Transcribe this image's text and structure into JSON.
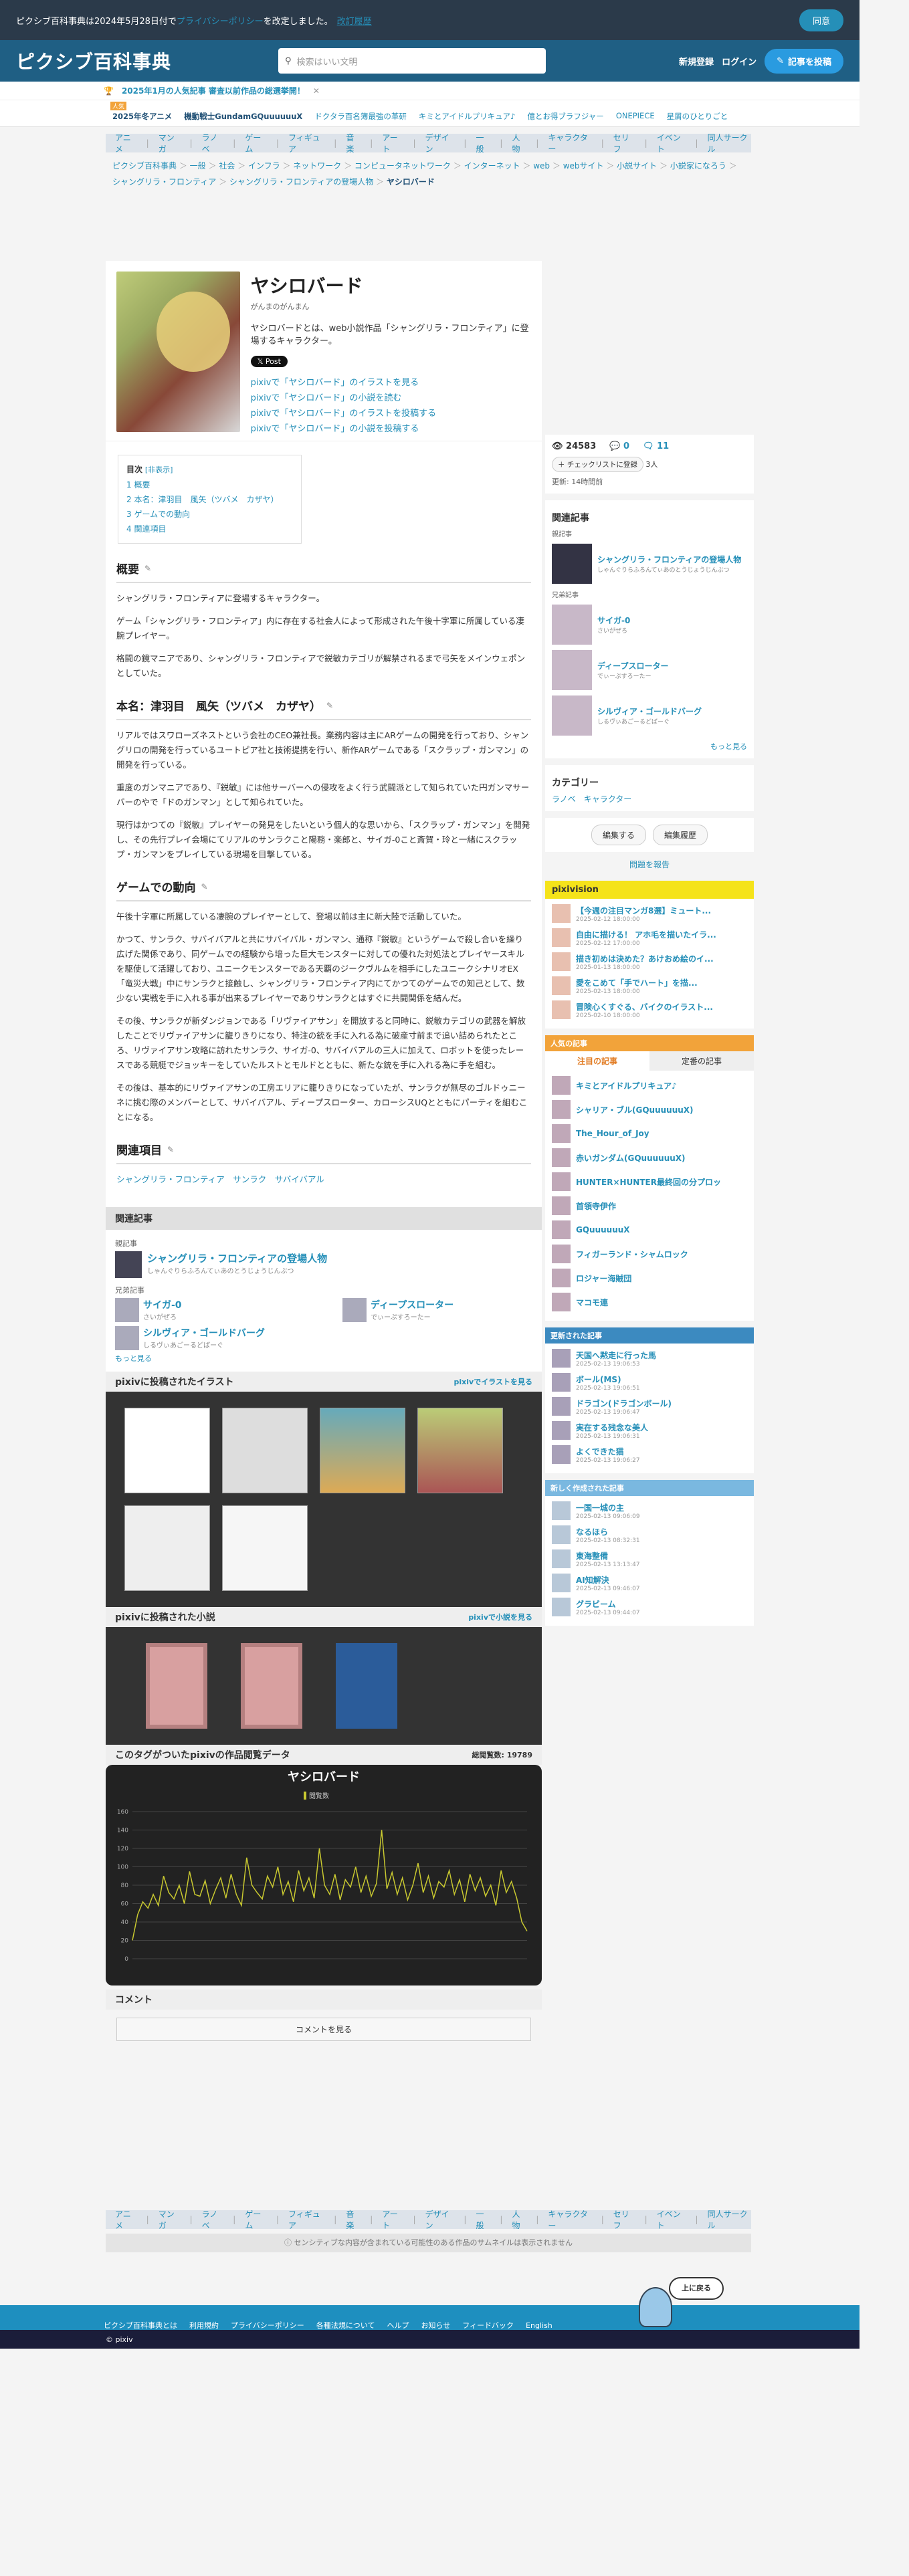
{
  "cookie": {
    "text": "ピクシブ百科事典は2024年5月28日付で",
    "link": "プライバシーポリシー",
    "text2": "を改定しました。",
    "link2": "改訂履歴",
    "agree": "同意"
  },
  "header": {
    "logo": "ピクシブ百科事典",
    "search_placeholder": "検索はいい文明",
    "signup": "新規登録",
    "login": "ログイン",
    "post": "記事を投稿"
  },
  "banner": {
    "icon": "🏆",
    "text": "2025年1月の人気記事 審査以前作品の総選挙開！",
    "close": "✕"
  },
  "trend": {
    "tag": "人気",
    "items": [
      "2025年冬アニメ",
      "機動戦士GundamGQuuuuuuX",
      "ドクタラ百名簿最強の革研",
      "キミとアイドルプリキュア♪",
      "億とお得ブラフジャー",
      "ONEPIECE",
      "星屑のひとりごと"
    ]
  },
  "catbar": [
    "アニメ",
    "マンガ",
    "ラノベ",
    "ゲーム",
    "フィギュア",
    "音楽",
    "アート",
    "デザイン",
    "一般",
    "人物",
    "キャラクター",
    "セリフ",
    "イベント",
    "同人サークル"
  ],
  "breadcrumb": [
    "ピクシブ百科事典",
    "一般",
    "社会",
    "インフラ",
    "ネットワーク",
    "コンピュータネットワーク",
    "インターネット",
    "web",
    "webサイト",
    "小説サイト",
    "小説家になろう",
    "シャングリラ・フロンティア",
    "シャングリラ・フロンティアの登場人物",
    "ヤシロバード"
  ],
  "article": {
    "title": "ヤシロバード",
    "yomi": "がんまのがんまん",
    "desc": "ヤシロバードとは、web小説作品「シャングリラ・フロンティア」に登場するキャラクター。",
    "xpost": "𝕏 Post",
    "plinks": [
      "pixivで「ヤシロバード」のイラストを見る",
      "pixivで「ヤシロバード」の小説を読む",
      "pixivで「ヤシロバード」のイラストを投稿する",
      "pixivで「ヤシロバード」の小説を投稿する"
    ]
  },
  "toc": {
    "head": "目次",
    "hide": "[非表示]",
    "items": [
      "1 概要",
      "2 本名：津羽目　風矢（ツバメ　カザヤ）",
      "3 ゲームでの動向",
      "4 関連項目"
    ]
  },
  "sections": [
    {
      "h": "概要",
      "p": [
        "シャングリラ・フロンティアに登場するキャラクター。",
        "ゲーム「シャングリラ・フロンティア」内に存在する社会人によって形成された午後十字軍に所属している凄腕プレイヤー。",
        "格闘の鏡マニアであり、シャングリラ・フロンティアで鋭敏カテゴリが解禁されるまで弓矢をメインウェポンとしていた。"
      ]
    },
    {
      "h": "本名：津羽目　風矢（ツバメ　カザヤ）",
      "p": [
        "リアルではスワローズネストという会社のCEO兼社長。業務内容は主にARゲームの開発を行っており、シャングリロの開発を行っているユートピア社と技術提携を行い、新作ARゲームである「スクラップ・ガンマン」の開発を行っている。",
        "重度のガンマニアであり、『鋭敏』には他サーバーへの侵攻をよく行う武闘派として知られていた円ガンマサーバーのやで「ドのガンマン」として知られていた。",
        "現行はかつての『鋭敏』プレイヤーの発見をしたいという個人的な思いから、「スクラップ・ガンマン」を開発し、その先行プレイ会場にてリアルのサンラクこと陽務・楽郎と、サイガ-0こと斎賀・玲と一緒にスクラップ・ガンマンをプレイしている現場を目撃している。"
      ]
    },
    {
      "h": "ゲームでの動向",
      "p": [
        "午後十字軍に所属している凄腕のプレイヤーとして、登場以前は主に新大陸で活動していた。",
        "かつて、サンラク、サバイバアルと共にサバイバル・ガンマン、通称『鋭敏』というゲームで殺し合いを繰り広げた関係であり、同ゲームでの経験から培った巨大モンスターに対しての優れた対処法とプレイヤースキルを駆使して活躍しており、ユニークモンスターである天覇のジークヴルムを相手にしたユニークシナリオEX「竜災大戦」中にサンラクと接触し、シャングリラ・フロンティア内にてかつてのゲームでの知己として、数少ない実戦を手に入れる事が出来るプレイヤーでありサンラクとはすぐに共闘関係を結んだ。",
        "その後、サンラクが新ダンジョンである「リヴァイアサン」を開放すると同時に、鋭敏カテゴリの武器を解放したことでリヴァイアサンに籠りきりになり、特注の銃を手に入れる為に破産寸前まで追い詰められたところ、リヴァイアサン攻略に訪れたサンラク、サイガ-0、サバイバアルの三人に加えて、ロボットを使ったレースである競艇でジョッキーをしていたルストとモルドとともに、新たな銃を手に入れる為に手を組む。",
        "その後は、基本的にリヴァイアサンの工房エリアに籠りきりになっていたが、サンラクが無尽のゴルドゥニーネに挑む際のメンバーとして、サバイバアル、ディープスローター、カローシスUQとともにパーティを組むことになる。"
      ]
    },
    {
      "h": "関連項目",
      "p": [
        "シャングリラ・フロンティア　サンラク　サバイバアル"
      ]
    }
  ],
  "related": {
    "head": "関連記事",
    "parent_label": "親記事",
    "parent": "シャングリラ・フロンティアの登場人物",
    "parent_yomi": "しゃんぐりらふろんてぃあのとうじょうじんぶつ",
    "sib_label": "兄弟記事",
    "sibs": [
      {
        "t": "サイガ-0",
        "y": "さいがぜろ"
      },
      {
        "t": "ディープスローター",
        "y": "でぃーぷすろーたー"
      },
      {
        "t": "シルヴィア・ゴールドバーグ",
        "y": "しるヴぃあごーるどばーぐ"
      }
    ],
    "more": "もっと見る"
  },
  "illust": {
    "head": "pixivに投稿されたイラスト",
    "link": "pixivでイラストを見る"
  },
  "novel": {
    "head": "pixivに投稿された小説",
    "link": "pixivで小説を見る"
  },
  "views": {
    "head": "このタグがついたpixivの作品閲覧データ",
    "total_label": "総閲覧数:",
    "total": "19789"
  },
  "chart_data": {
    "type": "line",
    "title": "ヤシロバード",
    "legend": "閲覧数",
    "ylim": [
      0,
      160
    ],
    "yticks": [
      0,
      20,
      40,
      60,
      80,
      100,
      120,
      140,
      160
    ],
    "values": [
      20,
      48,
      62,
      55,
      70,
      58,
      90,
      72,
      65,
      80,
      60,
      95,
      70,
      68,
      85,
      60,
      75,
      88,
      66,
      92,
      70,
      58,
      110,
      80,
      72,
      65,
      90,
      78,
      100,
      70,
      84,
      62,
      96,
      74,
      88,
      66,
      120,
      80,
      70,
      92,
      64,
      86,
      78,
      100,
      72,
      90,
      68,
      82,
      140,
      76,
      94,
      70,
      88,
      64,
      80,
      104,
      72,
      90,
      66,
      84,
      78,
      96,
      70,
      86,
      62,
      92,
      74,
      88,
      68,
      80,
      58,
      96,
      72,
      84,
      66,
      40,
      30
    ]
  },
  "comments": {
    "head": "コメント",
    "btn": "コメントを見る"
  },
  "notice": "センシティブな内容が含まれている可能性のある作品のサムネイルは表示されません",
  "side": {
    "views": "24583",
    "comments": "0",
    "edits": "11",
    "checklist": "＋ チェックリストに登録",
    "check_count": "3人",
    "updated": "更新: 14時間前",
    "rel_head": "関連記事",
    "parent_label": "親記事",
    "parent": "シャングリラ・フロンティアの登場人物",
    "parent_yomi": "しゃんぐりらふろんてぃあのとうじょうじんぶつ",
    "sib_label": "兄弟記事",
    "sibs": [
      {
        "t": "サイガ-0",
        "y": "さいがぜろ"
      },
      {
        "t": "ディープスローター",
        "y": "でぃーぷすろーたー"
      },
      {
        "t": "シルヴィア・ゴールドバーグ",
        "y": "しるヴぃあごーるどばーぐ"
      }
    ],
    "more": "もっと見る",
    "cat_head": "カテゴリー",
    "cats": [
      "ラノベ",
      "キャラクター"
    ],
    "edit": "編集する",
    "history": "編集履歴",
    "report": "問題を報告",
    "pixivision": "pixivision",
    "vision": [
      {
        "t": "【今週の注目マンガ8選】ミュート...",
        "d": "2025-02-12 18:00:00"
      },
      {
        "t": "自由に描ける！ アホ毛を描いたイラ...",
        "d": "2025-02-12 17:00:00"
      },
      {
        "t": "描き初めは決めた？あけおめ絵のイ...",
        "d": "2025-01-13 18:00:00"
      },
      {
        "t": "愛をこめて「手でハート」を描...",
        "d": "2025-02-13 18:00:00"
      },
      {
        "t": "冒険心くすぐる、バイクのイラスト...",
        "d": "2025-02-10 18:00:00"
      }
    ],
    "pop_head": "人気の記事",
    "pop_tabs": [
      "注目の記事",
      "定番の記事"
    ],
    "pop": [
      "キミとアイドルプリキュア♪",
      "シャリア・ブル(GQuuuuuuX)",
      "The_Hour_of_Joy",
      "赤いガンダム(GQuuuuuuX)",
      "HUNTER×HUNTER最終回の分プロッ",
      "首領寺伊作",
      "GQuuuuuuX",
      "フィガーランド・シャムロック",
      "ロジャー海賊団",
      "マコモ連"
    ],
    "upd_head": "更新された記事",
    "upd": [
      {
        "t": "天国へ黙走に行った馬",
        "d": "2025-02-13 19:06:53"
      },
      {
        "t": "ボール(MS)",
        "d": "2025-02-13 19:06:51"
      },
      {
        "t": "ドラゴン(ドラゴンボール)",
        "d": "2025-02-13 19:06:47"
      },
      {
        "t": "実在する残念な美人",
        "d": "2025-02-13 19:06:31"
      },
      {
        "t": "よくできた猫",
        "d": "2025-02-13 19:06:27"
      }
    ],
    "new_head": "新しく作成された記事",
    "new": [
      {
        "t": "一国一城の主",
        "d": "2025-02-13 09:06:09"
      },
      {
        "t": "なるほら",
        "d": "2025-02-13 08:32:31"
      },
      {
        "t": "東海整備",
        "d": "2025-02-13 13:13:47"
      },
      {
        "t": "AI知解決",
        "d": "2025-02-13 09:46:07"
      },
      {
        "t": "グラビーム",
        "d": "2025-02-13 09:44:07"
      }
    ]
  },
  "footer": {
    "links": [
      "ピクシブ百科事典とは",
      "利用規約",
      "プライバシーポリシー",
      "各種法規について",
      "ヘルプ",
      "お知らせ",
      "フィードバック",
      "English"
    ],
    "copy": "© pixiv",
    "top": "上に戻る"
  }
}
